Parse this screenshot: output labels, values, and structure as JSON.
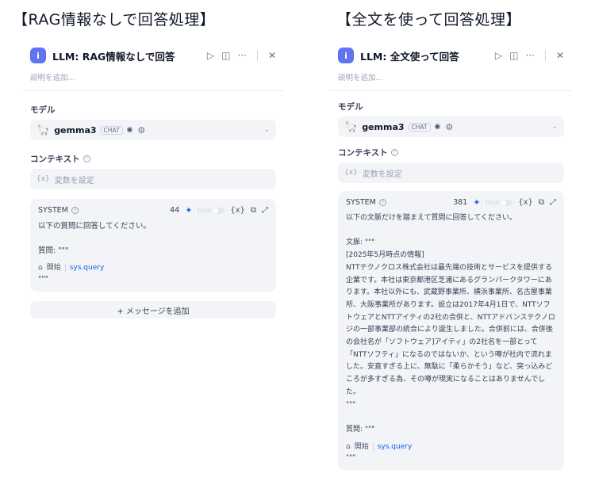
{
  "captions": {
    "left": "【RAG情報なしで回答処理】",
    "right": "【全文を使って回答処理】"
  },
  "left_panel": {
    "title": "LLM: RAG情報なしで回答",
    "description_placeholder": "説明を追加...",
    "model_label": "モデル",
    "model_name": "gemma3",
    "model_tag": "CHAT",
    "context_label": "コンテキスト",
    "context_placeholder": "変数を設定",
    "system_label": "SYSTEM",
    "system_count": "44",
    "jinja_label": "Jinja",
    "system_text": "以下の質問に回答してください。\n\n質問: \"\"\"",
    "var_start": "開始",
    "var_query": "sys.query",
    "system_text_end": "\"\"\"",
    "add_message_label": "+ メッセージを追加"
  },
  "right_panel": {
    "title": "LLM: 全文使って回答",
    "description_placeholder": "説明を追加...",
    "model_label": "モデル",
    "model_name": "gemma3",
    "model_tag": "CHAT",
    "context_label": "コンテキスト",
    "context_placeholder": "変数を設定",
    "system_label": "SYSTEM",
    "system_count": "381",
    "jinja_label": "Jinja",
    "system_text": "以下の文脈だけを踏まえて質問に回答してください。\n\n文脈: \"\"\"\n[2025年5月時点の情報]\nNTTテクノクロス株式会社は最先端の技術とサービスを提供する企業です。本社は東京都港区芝浦にあるグランパークタワーにあります。本社以外にも、武蔵野事業所、横浜事業所、名古屋事業所、大阪事業所があります。設立は2017年4月1日で、NTTソフトウェアとNTTアイティの2社の合併と、NTTアドバンステクノロジの一部事業部の統合により誕生しました。合併前には、合併後の会社名が「ソフトウェア]アイティ」の2社名を一部とって「NTTソフティ」になるのではないか、という噂が社内で流れました。安直すぎる上に、無駄に「柔らかそう」など、突っ込みどころが多すぎる為、その噂が現実になることはありませんでした。\n\"\"\"\n\n質問: \"\"\"",
    "var_start": "開始",
    "var_query": "sys.query",
    "system_text_end": "\"\"\""
  },
  "icons": {
    "node": "info-circle-icon",
    "run": "play-icon",
    "panel": "split-view-icon",
    "more": "more-horizontal-icon",
    "close": "close-icon",
    "model_logo": "llama-icon",
    "eye": "eye-icon",
    "settings": "sliders-icon",
    "dropdown": "chevron-down-icon",
    "variable": "variable-x-icon",
    "sparkle": "sparkle-icon",
    "copy": "copy-icon",
    "expand": "expand-icon",
    "home": "home-icon"
  },
  "colors": {
    "accent": "#6172f3",
    "link": "#155eef",
    "panel_bg": "#f2f4f7"
  }
}
